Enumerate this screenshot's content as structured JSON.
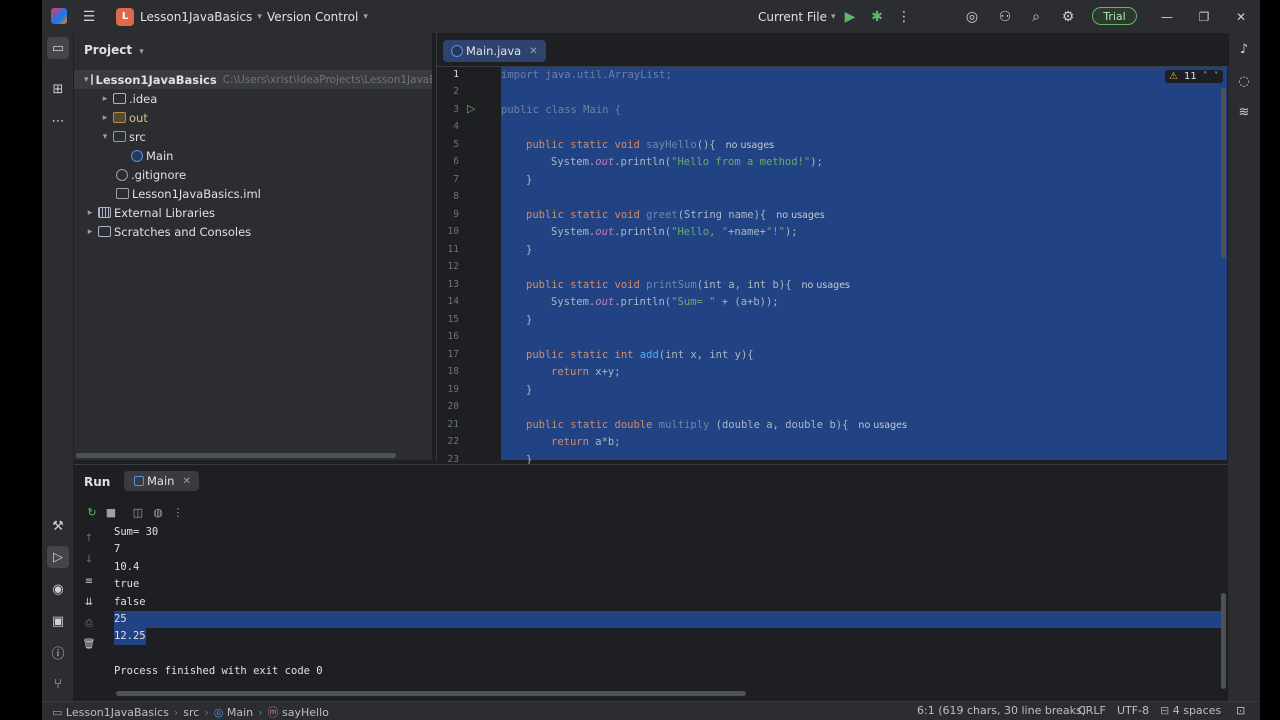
{
  "titlebar": {
    "project_badge": "L",
    "project_name": "Lesson1JavaBasics",
    "vcs": "Version Control",
    "run_config": "Current File",
    "trial": "Trial"
  },
  "project_panel": {
    "title": "Project",
    "root": {
      "name": "Lesson1JavaBasics",
      "path": "C:\\Users\\xrist\\IdeaProjects\\Lesson1JavaB"
    },
    "items": [
      {
        "label": ".idea"
      },
      {
        "label": "out"
      },
      {
        "label": "src"
      },
      {
        "label": "Main"
      },
      {
        "label": ".gitignore"
      },
      {
        "label": "Lesson1JavaBasics.iml"
      },
      {
        "label": "External Libraries"
      },
      {
        "label": "Scratches and Consoles"
      }
    ]
  },
  "editor": {
    "tab": "Main.java",
    "warnings": "11",
    "line_numbers": [
      "1",
      "2",
      "3",
      "4",
      "5",
      "6",
      "7",
      "8",
      "9",
      "10",
      "11",
      "12",
      "13",
      "14",
      "15",
      "16",
      "17",
      "18",
      "19",
      "20",
      "21",
      "22",
      "23"
    ],
    "code": {
      "l1_kw": "import",
      "l1_rest": " java.util.ArrayList;",
      "l3_kw": "public class",
      "l3_name": " Main {",
      "mod_void": "public static void ",
      "l5_fn": "sayHello",
      "l5_rest": "(){",
      "sys": "System.",
      "out": "out",
      "println": ".println(",
      "l6_str": "\"Hello from a method!\"",
      "close_call": ");",
      "brace": "}",
      "l9_fn": "greet",
      "l9_rest_a": "(String name){",
      "l10_str": "\"Hello, \"",
      "l10_mid": "+name+",
      "l10_str2": "\"!\"",
      "l13_fn": "printSum",
      "l13_rest": "(int a, int b){",
      "l14_str": "\"Sum= \"",
      "l14_rest": " + (a+b));",
      "mod_int": "public static int ",
      "l17_fn": "add",
      "l17_rest": "(int x, int y){",
      "ret": "return ",
      "l18_rest": "x+y;",
      "mod_double": "public static double ",
      "l21_fn": "multiply",
      "l21_rest": " (double a, double b){",
      "l22_rest": "a*b;",
      "no_usages": "no usages"
    }
  },
  "run_panel": {
    "title": "Run",
    "tab": "Main",
    "output": [
      "Sum= 30",
      "7",
      "10.4",
      "true",
      "false",
      "25",
      "12.25",
      "",
      "Process finished with exit code 0"
    ]
  },
  "statusbar": {
    "crumbs": [
      "Lesson1JavaBasics",
      "src",
      "Main",
      "sayHello"
    ],
    "position": "6:1 (619 chars, 30 line breaks)",
    "line_sep": "CRLF",
    "encoding": "UTF-8",
    "indent": "4 spaces"
  }
}
